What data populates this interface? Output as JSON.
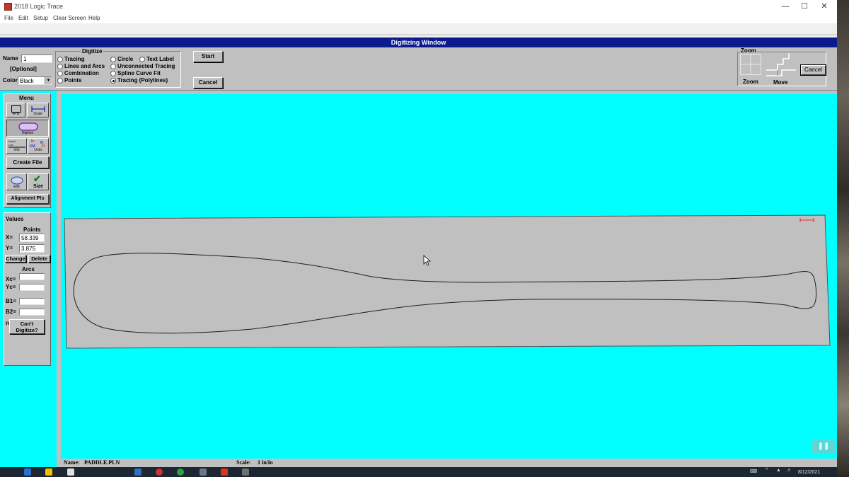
{
  "window": {
    "title": "2018 Logic Trace"
  },
  "menubar": [
    "File",
    "Edit",
    "Setup",
    "Clear Screen",
    "Help"
  ],
  "digitizing_window": {
    "title": "Digitizing Window"
  },
  "toolbar": {
    "name_label": "Name",
    "name_value": "1",
    "optional_label": "[Optional]",
    "color_label": "Color",
    "color_value": "Black",
    "digitize_label": "Digitize",
    "options": [
      {
        "label": "Tracing",
        "selected": false
      },
      {
        "label": "Lines and Arcs",
        "selected": false
      },
      {
        "label": "Combination",
        "selected": false
      },
      {
        "label": "Points",
        "selected": false
      },
      {
        "label": "Circle",
        "selected": false
      },
      {
        "label": "Unconnected Tracing",
        "selected": false
      },
      {
        "label": "Spline Curve Fit",
        "selected": false
      },
      {
        "label": "Tracing (Polylines)",
        "selected": true
      },
      {
        "label": "Text Label",
        "selected": false
      }
    ],
    "start_label": "Start",
    "cancel_label": "Cancel",
    "zoom_group_label": "Zoom",
    "zoom_label": "Zoom",
    "move_label": "Move",
    "zoom_cancel_label": "Cancel"
  },
  "menu_panel": {
    "title": "Menu",
    "tools": [
      "4Pts",
      "Scale",
      "Digitize",
      "Info",
      "Units",
      "Edit",
      "Size"
    ],
    "units_glyphs": [
      "In",
      "M",
      "KM",
      "Ft"
    ],
    "info_glyphs": [
      "Insert",
      "Loc"
    ],
    "create_file_label": "Create File",
    "alignment_label": "Alignment Pts"
  },
  "values_panel": {
    "title": "Values",
    "points_label": "Points",
    "x_label": "X=",
    "x_value": "58.339",
    "y_label": "Y=",
    "y_value": "3.875",
    "change_label": "Change",
    "delete_label": "Delete",
    "arcs_label": "Arcs",
    "xc_label": "Xc=",
    "yc_label": "Yc=",
    "b1_label": "B1=",
    "b2_label": "B2=",
    "n_label": "n",
    "cant_digitize_label": "Can't Digitize?"
  },
  "status": {
    "name_label": "Name:",
    "name_value": "PADDLE.PLN",
    "scale_label": "Scale:",
    "scale_value": "1 in/in"
  },
  "taskbar": {
    "date": "8/12/2021"
  },
  "colors": {
    "canvas": "#00ffff",
    "title_bar": "#0b1a8c",
    "panel": "#c0c0c0",
    "scale_marker": "#e03030"
  }
}
